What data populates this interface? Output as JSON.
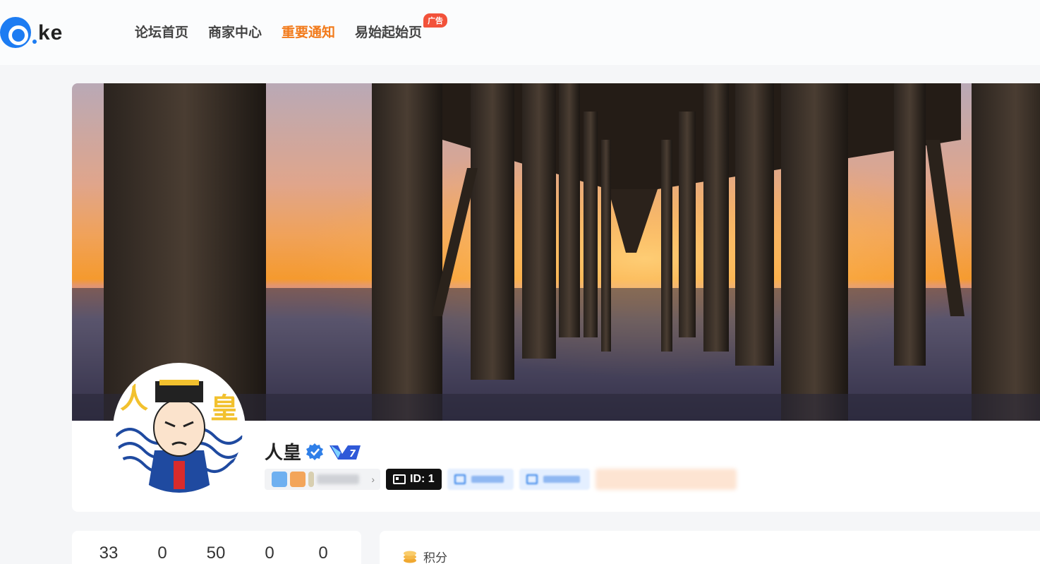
{
  "header": {
    "logo_text": "ke",
    "nav": [
      {
        "label": "论坛首页",
        "active": false
      },
      {
        "label": "商家中心",
        "active": false
      },
      {
        "label": "重要通知",
        "active": true
      },
      {
        "label": "易始起始页",
        "active": false,
        "badge": "广告"
      }
    ]
  },
  "profile": {
    "username": "人皇",
    "verified": true,
    "vip_level": "7",
    "avatar_text": [
      "人",
      "皇"
    ],
    "id_label": "ID: 1"
  },
  "stats": [
    "33",
    "0",
    "50",
    "0",
    "0"
  ],
  "points": {
    "title": "积分",
    "icon": "coin-stack-icon"
  },
  "colors": {
    "accent": "#f27a1a",
    "brand": "#1d7cf2",
    "ad_badge": "#f2523a"
  }
}
